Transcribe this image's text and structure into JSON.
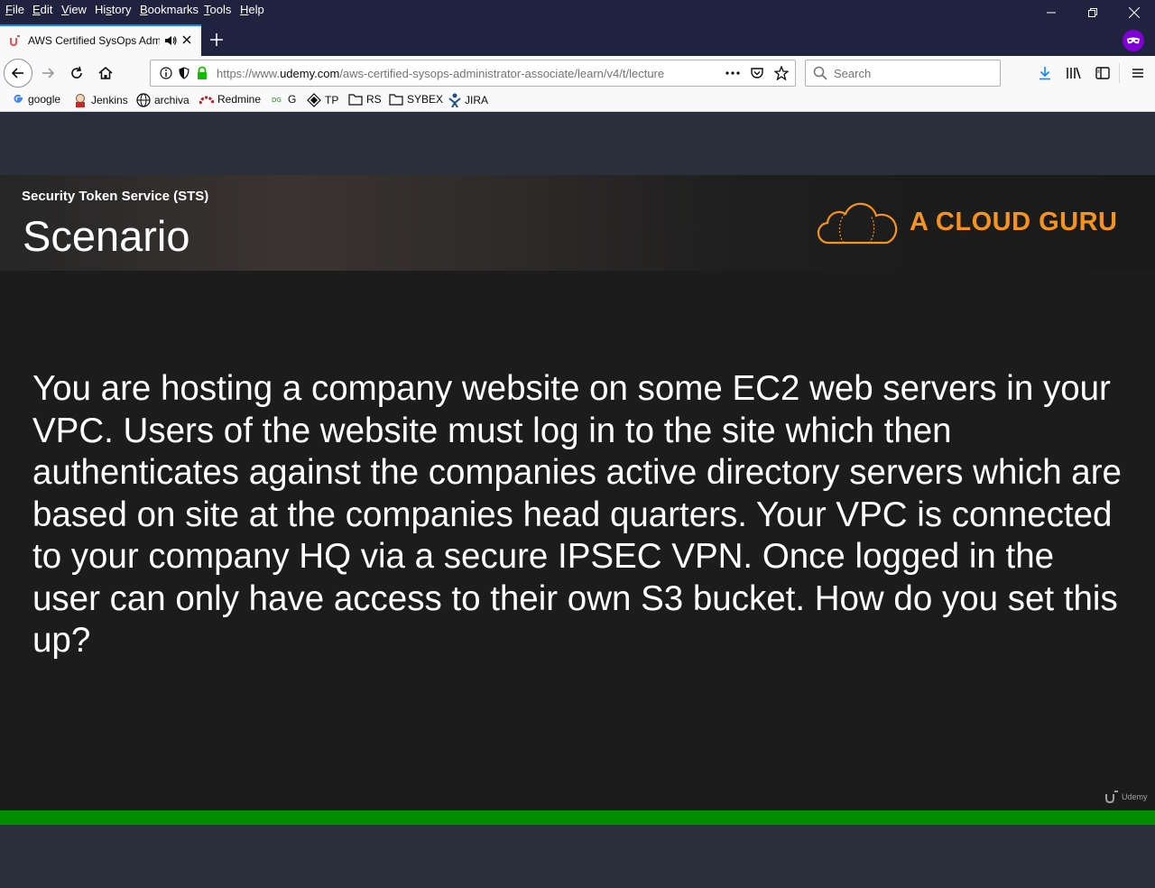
{
  "menubar": {
    "items": [
      {
        "accel": "F",
        "rest": "ile"
      },
      {
        "accel": "E",
        "rest": "dit"
      },
      {
        "accel": "V",
        "rest": "iew"
      },
      {
        "pre": "Hi",
        "accel": "s",
        "rest": "tory"
      },
      {
        "accel": "B",
        "rest": "ookmarks"
      },
      {
        "accel": "T",
        "rest": "ools"
      },
      {
        "accel": "H",
        "rest": "elp"
      }
    ]
  },
  "tab": {
    "title": "AWS Certified SysOps Administrator - Associate | Udemy",
    "favicon": "udemy-icon",
    "audio_icon": "speaker-icon"
  },
  "navbar": {
    "url_prefix": "https://www.",
    "url_domain": "udemy.com",
    "url_path": "/aws-certified-sysops-administrator-associate/learn/v4/t/lecture",
    "search_placeholder": "Search"
  },
  "bookmarks": {
    "items": [
      {
        "label": "google",
        "icon": "google-icon"
      },
      {
        "label": "Jenkins",
        "icon": "jenkins-icon"
      },
      {
        "label": "archiva",
        "icon": "globe-icon"
      },
      {
        "label": "Redmine",
        "icon": "redmine-icon"
      },
      {
        "label": "G",
        "icon": "dg-icon"
      },
      {
        "label": "TP",
        "icon": "tp-icon"
      },
      {
        "label": "RS",
        "icon": "folder-icon"
      },
      {
        "label": "SYBEX",
        "icon": "folder-icon"
      },
      {
        "label": "JIRA",
        "icon": "jira-icon"
      }
    ]
  },
  "slide": {
    "subtitle": "Security Token Service (STS)",
    "title": "Scenario",
    "brand": "A CLOUD GURU",
    "body": "You are hosting a company website on some EC2 web servers in your VPC. Users of the website must log in to the site which then authenticates against the companies active directory servers which are based on site at the companies head quarters. Your VPC is connected to your company HQ via a secure IPSEC VPN. Once logged in the user can only have access to their own S3 bucket. How do you set this up?",
    "watermark": "Udemy"
  },
  "player": {
    "progress": 1.0
  },
  "colors": {
    "brand_orange": "#f6931e",
    "progress_green": "#008e00",
    "browser_chrome": "#202340"
  }
}
